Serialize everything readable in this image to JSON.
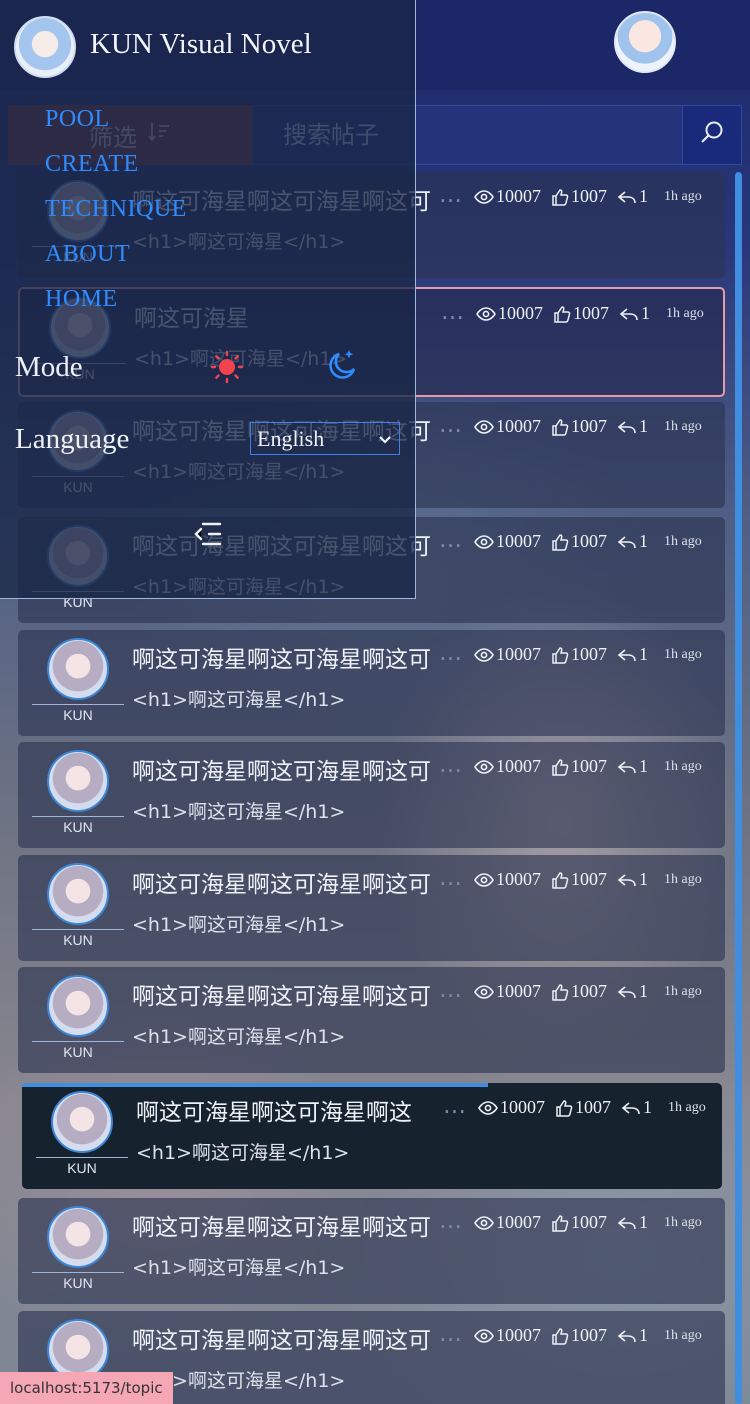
{
  "app": {
    "name": "KUN Visual Novel",
    "status_url": "localhost:5173/topic"
  },
  "nav": {
    "links": [
      "POOL",
      "CREATE",
      "TECHNIQUE",
      "ABOUT",
      "HOME"
    ],
    "mode_label": "Mode",
    "language_label": "Language",
    "language_selected": "English"
  },
  "search": {
    "filter_label": "筛选",
    "placeholder": "搜索帖子"
  },
  "topics": [
    {
      "title": "啊这可海星啊这可海星啊这可",
      "content": "<h1>啊这可海星</h1>",
      "user": "KUN",
      "views": "10007",
      "likes": "1007",
      "replies": "1",
      "time": "1h ago"
    },
    {
      "title": "啊这可海星",
      "content": "<h1>啊这可海星</h1>",
      "user": "KUN",
      "views": "10007",
      "likes": "1007",
      "replies": "1",
      "time": "1h ago"
    },
    {
      "title": "啊这可海星啊这可海星啊这可",
      "content": "<h1>啊这可海星</h1>",
      "user": "KUN",
      "views": "10007",
      "likes": "1007",
      "replies": "1",
      "time": "1h ago"
    },
    {
      "title": "啊这可海星啊这可海星啊这可",
      "content": "<h1>啊这可海星</h1>",
      "user": "KUN",
      "views": "10007",
      "likes": "1007",
      "replies": "1",
      "time": "1h ago"
    },
    {
      "title": "啊这可海星啊这可海星啊这可",
      "content": "<h1>啊这可海星</h1>",
      "user": "KUN",
      "views": "10007",
      "likes": "1007",
      "replies": "1",
      "time": "1h ago"
    },
    {
      "title": "啊这可海星啊这可海星啊这可",
      "content": "<h1>啊这可海星</h1>",
      "user": "KUN",
      "views": "10007",
      "likes": "1007",
      "replies": "1",
      "time": "1h ago"
    },
    {
      "title": "啊这可海星啊这可海星啊这可",
      "content": "<h1>啊这可海星</h1>",
      "user": "KUN",
      "views": "10007",
      "likes": "1007",
      "replies": "1",
      "time": "1h ago"
    },
    {
      "title": "啊这可海星啊这可海星啊这可",
      "content": "<h1>啊这可海星</h1>",
      "user": "KUN",
      "views": "10007",
      "likes": "1007",
      "replies": "1",
      "time": "1h ago"
    },
    {
      "title": "啊这可海星啊这可海星啊这",
      "content": "<h1>啊这可海星</h1>",
      "user": "KUN",
      "views": "10007",
      "likes": "1007",
      "replies": "1",
      "time": "1h ago"
    },
    {
      "title": "啊这可海星啊这可海星啊这可",
      "content": "<h1>啊这可海星</h1>",
      "user": "KUN",
      "views": "10007",
      "likes": "1007",
      "replies": "1",
      "time": "1h ago"
    },
    {
      "title": "啊这可海星啊这可海星啊这可",
      "content": "<h1>啊这可海星</h1>",
      "user": "KUN",
      "views": "10007",
      "likes": "1007",
      "replies": "1",
      "time": "1h ago"
    }
  ],
  "colors": {
    "accent": "#2f8cff",
    "status_bar": "#f5a7b5",
    "highlight_border": "#e69aa5"
  },
  "icons": {
    "views": "eye-icon",
    "likes": "thumbs-up-icon",
    "replies": "reply-icon",
    "search": "search-icon",
    "filter": "sort-icon",
    "light_mode": "sun-icon",
    "dark_mode": "moon-icon",
    "collapse": "menu-collapse-icon"
  }
}
